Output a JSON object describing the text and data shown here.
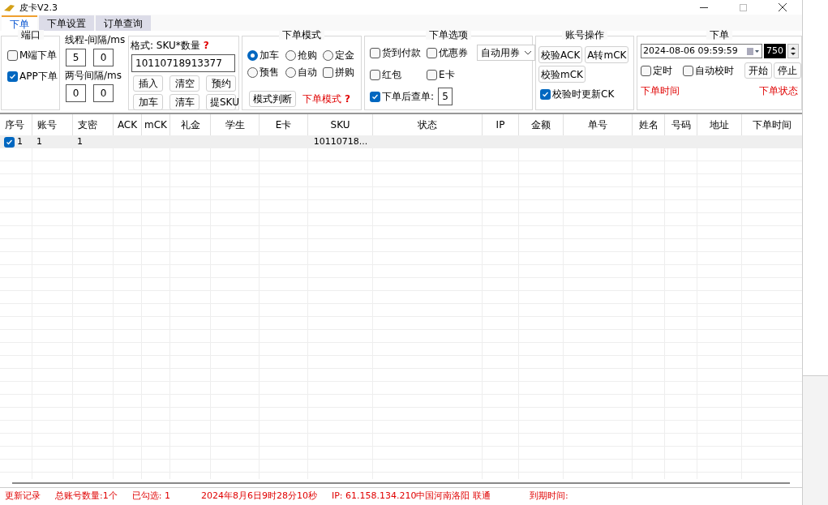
{
  "window": {
    "title": "皮卡V2.3"
  },
  "tabs": [
    {
      "label": "下单",
      "selected": true
    },
    {
      "label": "下单设置",
      "selected": false
    },
    {
      "label": "订单查询",
      "selected": false
    }
  ],
  "port": {
    "title": "端口",
    "options": [
      {
        "label": "M端下单",
        "checked": false
      },
      {
        "label": "APP下单",
        "checked": true
      }
    ]
  },
  "interval": {
    "thread_label": "线程-间隔/ms",
    "thread_values": [
      "5",
      "0"
    ],
    "account_label": "两号间隔/ms",
    "account_values": [
      "0",
      "0"
    ]
  },
  "format": {
    "label": "格式: SKU*数量",
    "help": "?",
    "value": "10110718913377",
    "buttons": [
      "插入",
      "清空",
      "预约",
      "加车",
      "清车",
      "提SKU"
    ]
  },
  "mode": {
    "title": "下单模式",
    "options": [
      {
        "kind": "radio",
        "label": "加车",
        "selected": true
      },
      {
        "kind": "radio",
        "label": "抢购",
        "selected": false
      },
      {
        "kind": "radio",
        "label": "定金",
        "selected": false
      },
      {
        "kind": "radio",
        "label": "预售",
        "selected": false
      },
      {
        "kind": "radio",
        "label": "自动",
        "selected": false
      },
      {
        "kind": "checkbox",
        "label": "拼购",
        "checked": false
      }
    ],
    "button": "模式判断",
    "hint": "下单模式",
    "help": "?"
  },
  "options": {
    "title": "下单选项",
    "items": [
      {
        "label": "货到付款",
        "checked": false
      },
      {
        "label": "优惠券",
        "checked": false
      },
      {
        "label": "红包",
        "checked": false
      },
      {
        "label": "E卡",
        "checked": false
      }
    ],
    "coupon_select": "自动用券",
    "check_after": {
      "label": "下单后查单:",
      "checked": true,
      "value": "5"
    }
  },
  "account_ops": {
    "title": "账号操作",
    "buttons": [
      "校验ACK",
      "A转mCK",
      "校验mCK"
    ],
    "update_ck": {
      "label": "校验时更新CK",
      "checked": true
    }
  },
  "order": {
    "title": "下单",
    "datetime": "2024-08-06 09:59:59",
    "ms": "750",
    "timed": {
      "label": "定时",
      "checked": false
    },
    "auto_sync": {
      "label": "自动校时",
      "checked": false
    },
    "start": "开始",
    "stop": "停止",
    "time_label": "下单时间",
    "status_label": "下单状态"
  },
  "table": {
    "columns": [
      "序号",
      "账号",
      "支密",
      "ACK",
      "mCK",
      "礼金",
      "学生",
      "E卡",
      "SKU",
      "状态",
      "IP",
      "金额",
      "单号",
      "姓名",
      "号码",
      "地址",
      "下单时间"
    ],
    "rows": [
      {
        "checked": true,
        "cells": [
          "1",
          "1",
          "1",
          "",
          "",
          "",
          "",
          "",
          "10110718...",
          "",
          "",
          "",
          "",
          "",
          "",
          "",
          ""
        ]
      }
    ]
  },
  "status_bar": [
    {
      "text": "更新记录"
    },
    {
      "text": "总账号数量:1个"
    },
    {
      "text": "已勾选: 1"
    },
    {
      "text": "2024年8月6日9时28分10秒"
    },
    {
      "text": "IP: 61.158.134.210中国河南洛阳 联通"
    },
    {
      "text": "到期时间:"
    }
  ]
}
